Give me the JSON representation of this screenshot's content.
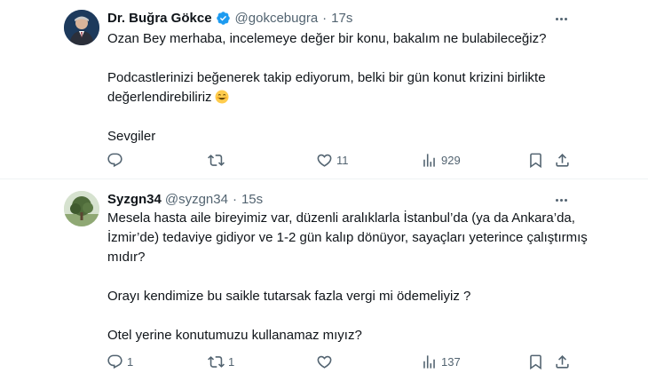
{
  "tweets": [
    {
      "name": "Dr. Buğra Gökce",
      "handle": "@gokcebugra",
      "separator": "·",
      "time": "17s",
      "paragraphs": [
        "Ozan Bey merhaba, incelemeye değer bir konu, bakalım ne bulabileceğiz?",
        "Podcastlerinizi beğenerek takip ediyorum, belki bir gün konut krizini birlikte değerlendirebiliriz",
        "Sevgiler"
      ],
      "verified": true,
      "emoji": "smiling-face-emoji",
      "actions": {
        "reply": "",
        "retweet": "",
        "like": "11",
        "views": "929"
      }
    },
    {
      "name": "Syzgn34",
      "handle": "@syzgn34",
      "separator": "·",
      "time": "15s",
      "paragraphs": [
        "Mesela hasta aile bireyimiz var, düzenli aralıklarla İstanbul’da (ya da Ankara’da, İzmir’de) tedaviye gidiyor ve 1-2 gün kalıp dönüyor, sayaçları yeterince çalıştırmış mıdır?",
        "Orayı kendimize bu saikle tutarsak fazla vergi mi ödemeliyiz ?",
        "Otel yerine konutumuzu kullanamaz mıyız?"
      ],
      "verified": false,
      "actions": {
        "reply": "1",
        "retweet": "1",
        "like": "",
        "views": "137"
      }
    }
  ],
  "colors": {
    "text": "#0f1419",
    "secondary": "#536471",
    "verified": "#1d9bf0",
    "divider": "#eff3f4"
  },
  "icons": [
    "reply-icon",
    "retweet-icon",
    "like-icon",
    "views-icon",
    "bookmark-icon",
    "share-icon",
    "more-icon",
    "verified-badge-icon"
  ]
}
